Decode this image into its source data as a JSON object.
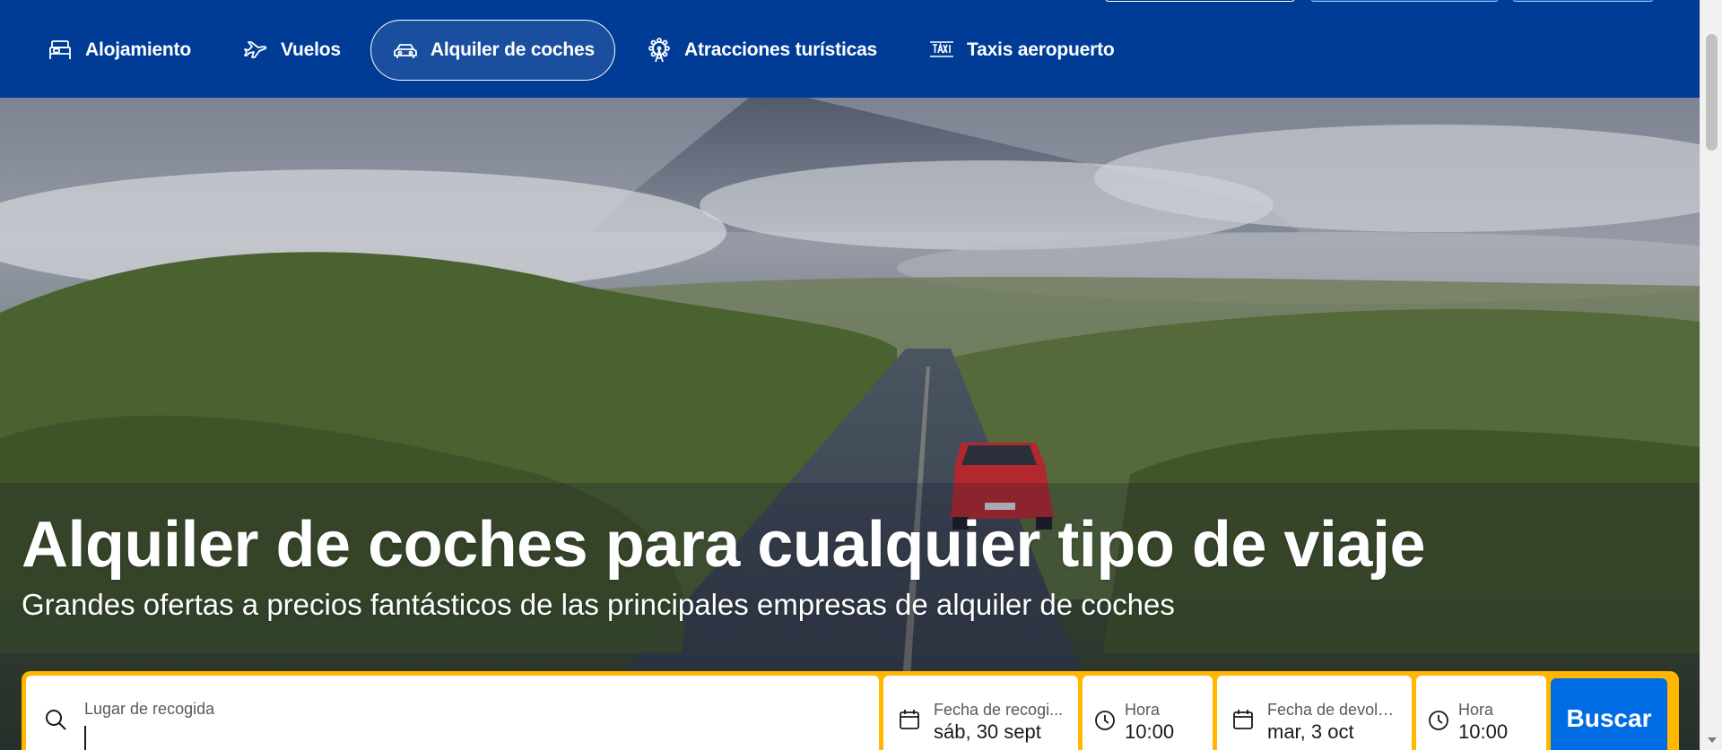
{
  "colors": {
    "brand_blue": "#003b95",
    "accent_yellow": "#ffb700",
    "button_blue": "#006ce4"
  },
  "nav": {
    "items": [
      {
        "label": "Alojamiento",
        "icon": "bed-icon",
        "active": false
      },
      {
        "label": "Vuelos",
        "icon": "plane-icon",
        "active": false
      },
      {
        "label": "Alquiler de coches",
        "icon": "car-icon",
        "active": true
      },
      {
        "label": "Atracciones turísticas",
        "icon": "ferris-wheel-icon",
        "active": false
      },
      {
        "label": "Taxis aeropuerto",
        "icon": "taxi-icon",
        "active": false
      }
    ]
  },
  "hero": {
    "title": "Alquiler de coches para cualquier tipo de viaje",
    "subtitle": "Grandes ofertas a precios fantásticos de las principales empresas de alquiler de coches"
  },
  "search": {
    "location": {
      "label": "Lugar de recogida",
      "value": "",
      "icon": "search-icon"
    },
    "pickup_date": {
      "label": "Fecha de recogi...",
      "value": "sáb, 30 sept",
      "icon": "calendar-icon"
    },
    "pickup_time": {
      "label": "Hora",
      "value": "10:00",
      "icon": "clock-icon"
    },
    "dropoff_date": {
      "label": "Fecha de devolu...",
      "value": "mar, 3 oct",
      "icon": "calendar-icon"
    },
    "dropoff_time": {
      "label": "Hora",
      "value": "10:00",
      "icon": "clock-icon"
    },
    "submit_label": "Buscar"
  }
}
